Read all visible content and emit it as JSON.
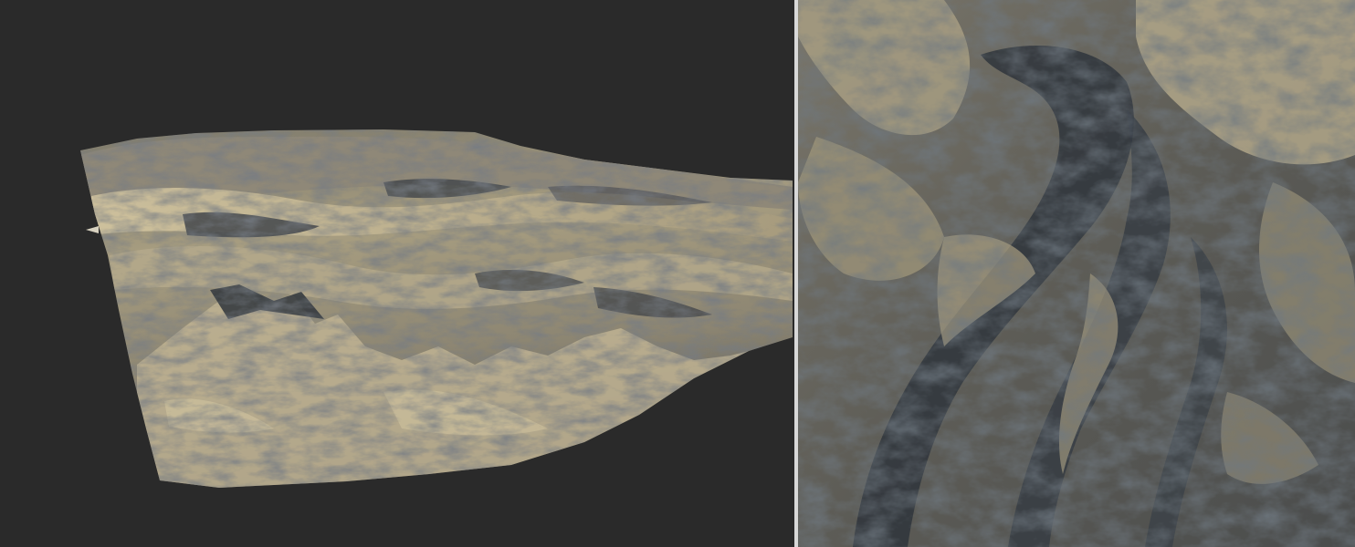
{
  "window": {
    "background_color": "#2a2a2a"
  },
  "viewports": {
    "perspective": {
      "kind": "perspective-3d-terrain-view",
      "background_color": "#2a2a2a",
      "terrain_light_color": "#c9bb98",
      "terrain_mid_color": "#8a8474",
      "terrain_shadow_color": "#2e343b"
    },
    "divider": {
      "color": "#d8d8d8"
    },
    "top": {
      "kind": "top-down-terrain-view",
      "terrain_light_color": "#b7ab8b",
      "terrain_mid_color": "#6f6b61",
      "terrain_shadow_color": "#2f353c"
    }
  }
}
